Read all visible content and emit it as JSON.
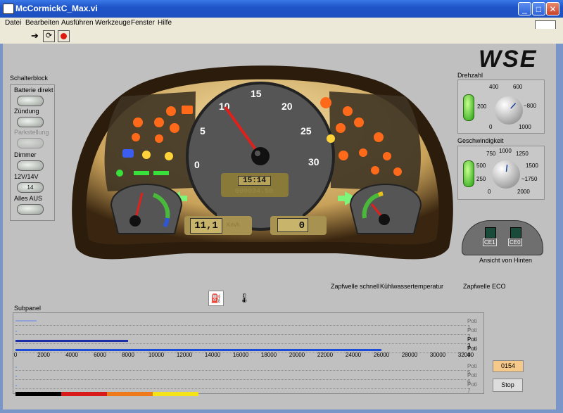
{
  "window": {
    "title": "McCormickC_Max.vi"
  },
  "menu": [
    "Datei",
    "Bearbeiten",
    "Ausführen",
    "Werkzeuge",
    "Fenster",
    "Hilfe"
  ],
  "logo": {
    "text": "WSE"
  },
  "schalterblock": {
    "title": "Schalterblock",
    "items": [
      {
        "label": "Batterie direkt",
        "enabled": true
      },
      {
        "label": "Zündung",
        "enabled": true
      },
      {
        "label": "Parkstellung",
        "enabled": false
      },
      {
        "label": "Dimmer",
        "enabled": true
      },
      {
        "label": "12V/14V",
        "enabled": true,
        "value": "14"
      },
      {
        "label": "Alles AUS",
        "enabled": true
      }
    ]
  },
  "tacho": {
    "ticks": [
      "0",
      "5",
      "10",
      "15",
      "20",
      "25",
      "30"
    ],
    "needle_value": 10,
    "clock": "15:14",
    "odometer": "000094.50",
    "speed_value": "11,1",
    "speed_unit": "Km/h",
    "second_value": "0"
  },
  "drehzahl": {
    "title": "Drehzahl",
    "ticks": [
      "0",
      "200",
      "400",
      "600",
      "~800",
      "1000"
    ],
    "value": 660
  },
  "geschwindigkeit": {
    "title": "Geschwindigkeit",
    "ticks": [
      "0",
      "250",
      "500",
      "750",
      "1000",
      "1250",
      "1500",
      "~1750",
      "2000"
    ],
    "value": 1050
  },
  "rear_view": {
    "label": "Ansicht von Hinten",
    "sockets": [
      "CE1",
      "CE0"
    ]
  },
  "bottom_labels": [
    "Zapfwelle schnell",
    "Kühlwassertemperatur",
    "Zapfwelle ECO"
  ],
  "subpanel": {
    "title": "Subpanel",
    "axis_ticks": [
      "0",
      "2000",
      "4000",
      "6000",
      "8000",
      "10000",
      "12000",
      "14000",
      "16000",
      "18000",
      "20000",
      "22000",
      "24000",
      "26000",
      "28000",
      "30000",
      "32000"
    ],
    "potis": [
      {
        "label": "Poti 1",
        "value": 1500,
        "color": "#8ea3d8"
      },
      {
        "label": "Poti 2",
        "value": 0,
        "color": "#8ea3d8"
      },
      {
        "label": "Poti 3",
        "value": 8000,
        "color": "#1c2fa8"
      },
      {
        "label": "Poti 4",
        "value": 26000,
        "color": "#1c4cd8"
      },
      {
        "label": "Poti 5",
        "value": 0,
        "color": "#8ea3d8"
      },
      {
        "label": "Poti 6",
        "value": 0,
        "color": "#8ea3d8"
      },
      {
        "label": "Poti 7",
        "value": 0,
        "color": "#8ea3d8"
      }
    ],
    "display_value": "0154",
    "stop_label": "Stop"
  }
}
